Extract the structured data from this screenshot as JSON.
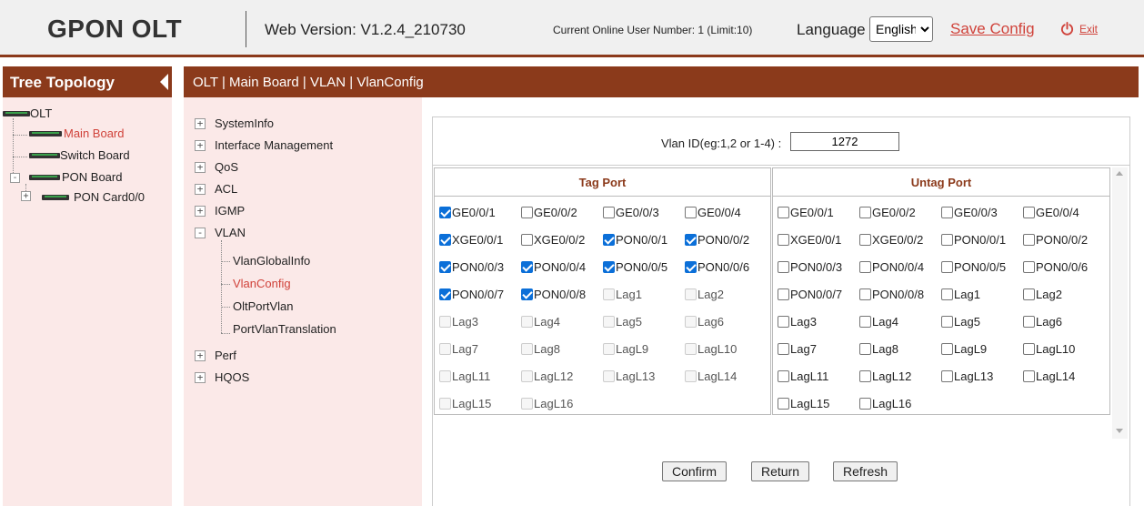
{
  "header": {
    "brand": "GPON OLT",
    "web_version": "Web Version: V1.2.4_210730",
    "online_users": "Current Online User Number: 1 (Limit:10)",
    "language_label": "Language",
    "language_selected": "English",
    "save_config": "Save Config",
    "exit": "Exit"
  },
  "tree": {
    "title": "Tree Topology",
    "nodes": {
      "olt": "OLT",
      "main_board": "Main Board",
      "switch_board": "Switch Board",
      "pon_board": "PON Board",
      "pon_card": "PON Card0/0"
    }
  },
  "breadcrumb": "OLT | Main Board | VLAN | VlanConfig",
  "menu": {
    "system_info": "SystemInfo",
    "interface_management": "Interface Management",
    "qos": "QoS",
    "acl": "ACL",
    "igmp": "IGMP",
    "vlan": "VLAN",
    "vlan_global_info": "VlanGlobalInfo",
    "vlan_config": "VlanConfig",
    "olt_port_vlan": "OltPortVlan",
    "port_vlan_translation": "PortVlanTranslation",
    "perf": "Perf",
    "hqos": "HQOS"
  },
  "form": {
    "vlan_id_label": "Vlan ID(eg:1,2 or 1-4) :",
    "vlan_id_value": "1272",
    "tag_title": "Tag Port",
    "untag_title": "Untag Port",
    "tag_ports": [
      {
        "label": "GE0/0/1",
        "checked": true,
        "disabled": false
      },
      {
        "label": "GE0/0/2",
        "checked": false,
        "disabled": false
      },
      {
        "label": "GE0/0/3",
        "checked": false,
        "disabled": false
      },
      {
        "label": "GE0/0/4",
        "checked": false,
        "disabled": false
      },
      {
        "label": "XGE0/0/1",
        "checked": true,
        "disabled": false
      },
      {
        "label": "XGE0/0/2",
        "checked": false,
        "disabled": false
      },
      {
        "label": "PON0/0/1",
        "checked": true,
        "disabled": false
      },
      {
        "label": "PON0/0/2",
        "checked": true,
        "disabled": false
      },
      {
        "label": "PON0/0/3",
        "checked": true,
        "disabled": false
      },
      {
        "label": "PON0/0/4",
        "checked": true,
        "disabled": false
      },
      {
        "label": "PON0/0/5",
        "checked": true,
        "disabled": false
      },
      {
        "label": "PON0/0/6",
        "checked": true,
        "disabled": false
      },
      {
        "label": "PON0/0/7",
        "checked": true,
        "disabled": false
      },
      {
        "label": "PON0/0/8",
        "checked": true,
        "disabled": false
      },
      {
        "label": "Lag1",
        "checked": false,
        "disabled": true
      },
      {
        "label": "Lag2",
        "checked": false,
        "disabled": true
      },
      {
        "label": "Lag3",
        "checked": false,
        "disabled": true
      },
      {
        "label": "Lag4",
        "checked": false,
        "disabled": true
      },
      {
        "label": "Lag5",
        "checked": false,
        "disabled": true
      },
      {
        "label": "Lag6",
        "checked": false,
        "disabled": true
      },
      {
        "label": "Lag7",
        "checked": false,
        "disabled": true
      },
      {
        "label": "Lag8",
        "checked": false,
        "disabled": true
      },
      {
        "label": "LagL9",
        "checked": false,
        "disabled": true
      },
      {
        "label": "LagL10",
        "checked": false,
        "disabled": true
      },
      {
        "label": "LagL11",
        "checked": false,
        "disabled": true
      },
      {
        "label": "LagL12",
        "checked": false,
        "disabled": true
      },
      {
        "label": "LagL13",
        "checked": false,
        "disabled": true
      },
      {
        "label": "LagL14",
        "checked": false,
        "disabled": true
      },
      {
        "label": "LagL15",
        "checked": false,
        "disabled": true
      },
      {
        "label": "LagL16",
        "checked": false,
        "disabled": true
      }
    ],
    "untag_ports": [
      {
        "label": "GE0/0/1",
        "checked": false,
        "disabled": false
      },
      {
        "label": "GE0/0/2",
        "checked": false,
        "disabled": false
      },
      {
        "label": "GE0/0/3",
        "checked": false,
        "disabled": false
      },
      {
        "label": "GE0/0/4",
        "checked": false,
        "disabled": false
      },
      {
        "label": "XGE0/0/1",
        "checked": false,
        "disabled": false
      },
      {
        "label": "XGE0/0/2",
        "checked": false,
        "disabled": false
      },
      {
        "label": "PON0/0/1",
        "checked": false,
        "disabled": false
      },
      {
        "label": "PON0/0/2",
        "checked": false,
        "disabled": false
      },
      {
        "label": "PON0/0/3",
        "checked": false,
        "disabled": false
      },
      {
        "label": "PON0/0/4",
        "checked": false,
        "disabled": false
      },
      {
        "label": "PON0/0/5",
        "checked": false,
        "disabled": false
      },
      {
        "label": "PON0/0/6",
        "checked": false,
        "disabled": false
      },
      {
        "label": "PON0/0/7",
        "checked": false,
        "disabled": false
      },
      {
        "label": "PON0/0/8",
        "checked": false,
        "disabled": false
      },
      {
        "label": "Lag1",
        "checked": false,
        "disabled": false
      },
      {
        "label": "Lag2",
        "checked": false,
        "disabled": false
      },
      {
        "label": "Lag3",
        "checked": false,
        "disabled": false
      },
      {
        "label": "Lag4",
        "checked": false,
        "disabled": false
      },
      {
        "label": "Lag5",
        "checked": false,
        "disabled": false
      },
      {
        "label": "Lag6",
        "checked": false,
        "disabled": false
      },
      {
        "label": "Lag7",
        "checked": false,
        "disabled": false
      },
      {
        "label": "Lag8",
        "checked": false,
        "disabled": false
      },
      {
        "label": "LagL9",
        "checked": false,
        "disabled": false
      },
      {
        "label": "LagL10",
        "checked": false,
        "disabled": false
      },
      {
        "label": "LagL11",
        "checked": false,
        "disabled": false
      },
      {
        "label": "LagL12",
        "checked": false,
        "disabled": false
      },
      {
        "label": "LagL13",
        "checked": false,
        "disabled": false
      },
      {
        "label": "LagL14",
        "checked": false,
        "disabled": false
      },
      {
        "label": "LagL15",
        "checked": false,
        "disabled": false
      },
      {
        "label": "LagL16",
        "checked": false,
        "disabled": false
      }
    ],
    "buttons": {
      "confirm": "Confirm",
      "return": "Return",
      "refresh": "Refresh"
    }
  },
  "colors": {
    "accent": "#8b3a1b",
    "link": "#d0423a",
    "panel_bg": "#fbe9e8",
    "checkbox_checked": "#0b6fd8"
  },
  "icons": {
    "exit": "power-icon",
    "collapse": "triangle-left-icon",
    "device": "device-icon"
  }
}
